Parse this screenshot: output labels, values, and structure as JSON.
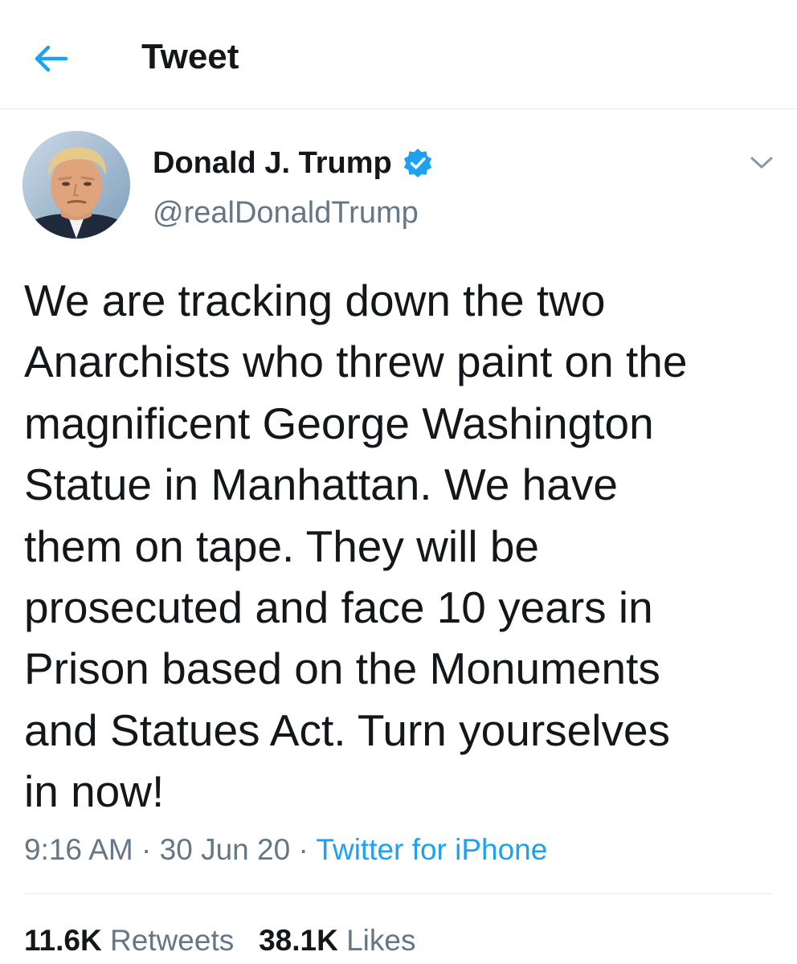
{
  "header": {
    "back_icon": "arrow-left-icon",
    "title": "Tweet"
  },
  "colors": {
    "accent": "#1da1f2",
    "text_primary": "#14171a",
    "text_secondary": "#657786",
    "divider": "#e6ecf0"
  },
  "tweet": {
    "author": {
      "name": "Donald J. Trump",
      "handle": "@realDonaldTrump",
      "verified_icon": "verified-badge-icon",
      "avatar_icon": "avatar"
    },
    "menu_icon": "chevron-down-icon",
    "text": "We are tracking down the two\nAnarchists who threw paint on the\nmagnificent George Washington\nStatue in Manhattan. We have\nthem on tape. They will be\nprosecuted and face 10 years in\nPrison based on the Monuments\nand Statues Act. Turn yourselves\nin now!",
    "time": "9:16 AM",
    "date": "30 Jun 20",
    "separator": "·",
    "source": "Twitter for iPhone",
    "stats": {
      "retweets_count": "11.6K",
      "retweets_label": "Retweets",
      "likes_count": "38.1K",
      "likes_label": "Likes"
    }
  }
}
